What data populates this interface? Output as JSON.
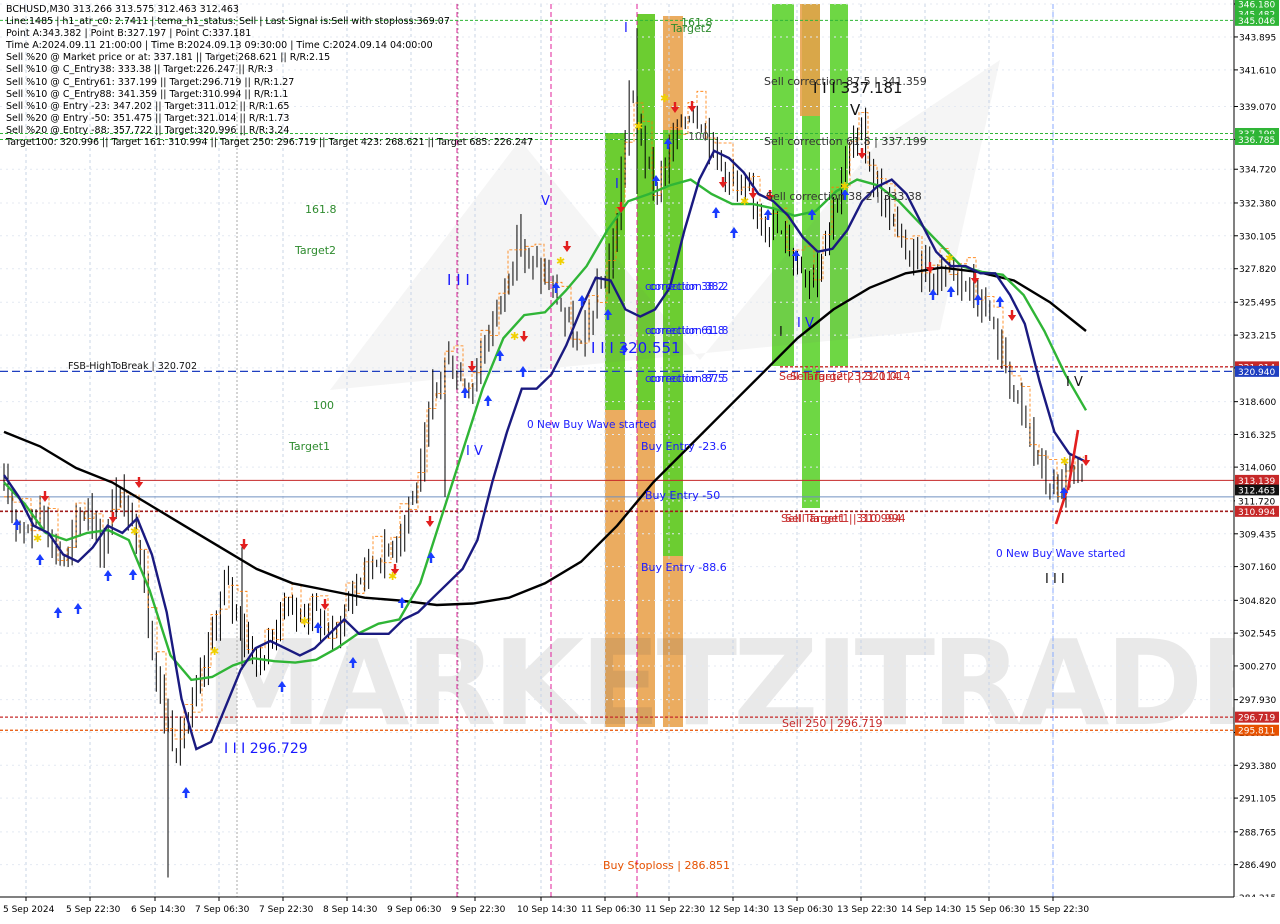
{
  "header": {
    "lines": [
      "BCHUSD,M30  313.266 313.575 312.463 312.463",
      "Line:1485  |  h1_atr_c0: 2.7411  |  tema_h1_status: Sell  |  Last Signal is:Sell with stoploss:369.07",
      "Point A:343.382  |  Point B:327.197  |  Point C:337.181",
      "Time A:2024.09.11 21:00:00  |  Time B:2024.09.13 09:30:00  |  Time C:2024.09.14 04:00:00",
      "Sell %20 @ Market price or at: 337.181  ||  Target:268.621  ||  R/R:2.15",
      "Sell %10 @ C_Entry38: 333.38  ||  Target:226.247  ||  R/R:3",
      "Sell %10 @ C_Entry61: 337.199  ||  Target:296.719  ||  R/R:1.27",
      "Sell %10 @ C_Entry88: 341.359  ||  Target:310.994  ||  R/R:1.1",
      "Sell %10 @ Entry -23: 347.202  ||  Target:311.012  ||  R/R:1.65",
      "Sell %20 @ Entry -50: 351.475  ||  Target:321.014  ||  R/R:1.73",
      "Sell %20 @ Entry -88: 357.722  ||  Target:320.996  ||  R/R:3.24",
      "Target100: 320.996  ||  Target 161: 310.994  ||  Target 250: 296.719  ||  Target 423: 268.621  ||  Target 685: 226.247"
    ]
  },
  "watermark": "MARKETZITRADE",
  "chart_data": {
    "type": "candlestick",
    "symbol": "BCHUSD",
    "timeframe": "M30",
    "ylim": [
      284.245,
      346.18
    ],
    "y_ticks": [
      "346.180",
      "343.895",
      "341.610",
      "339.070",
      "336.785",
      "334.720",
      "332.380",
      "330.105",
      "327.820",
      "325.495",
      "323.215",
      "320.940",
      "318.600",
      "316.325",
      "314.060",
      "311.720",
      "309.435",
      "307.160",
      "304.820",
      "302.545",
      "300.270",
      "297.930",
      "295.655",
      "293.380",
      "291.105",
      "288.765",
      "286.490",
      "284.215"
    ],
    "x_tick_labels": [
      "5 Sep 2024",
      "5 Sep 22:30",
      "6 Sep 14:30",
      "7 Sep 06:30",
      "7 Sep 22:30",
      "8 Sep 14:30",
      "9 Sep 06:30",
      "9 Sep 22:30",
      "10 Sep 14:30",
      "11 Sep 06:30",
      "11 Sep 22:30",
      "12 Sep 14:30",
      "13 Sep 06:30",
      "13 Sep 22:30",
      "14 Sep 14:30",
      "15 Sep 06:30",
      "15 Sep 22:30"
    ],
    "price_path": [
      312.5,
      310.5,
      309.8,
      311.5,
      308.5,
      307.5,
      310.2,
      311.5,
      307.8,
      312.5,
      311,
      309,
      302,
      297,
      294.5,
      296.5,
      299,
      302.5,
      306,
      304,
      301.5,
      300.5,
      302.5,
      305,
      303.5,
      304.5,
      303,
      302.3,
      304.5,
      306.5,
      307.5,
      308,
      309,
      311.5,
      313.5,
      319,
      321.5,
      320.5,
      319.5,
      322,
      324.5,
      327,
      330,
      328,
      327.5,
      326,
      324,
      322,
      325,
      327,
      330.5,
      340,
      337,
      333,
      335,
      337.5,
      339,
      338,
      336,
      334.5,
      333,
      332.5,
      331.5,
      330.5,
      329.5,
      328,
      327.2,
      330,
      333,
      336,
      337.2,
      334,
      332,
      330,
      328.5,
      328,
      327.2,
      328,
      327.5,
      326.5,
      325.5,
      323,
      320.5,
      318,
      315.5,
      313,
      312.5,
      313.5,
      312.46
    ],
    "moving_averages": {
      "navy": [
        313.5,
        312,
        310,
        309.5,
        308,
        307.5,
        308.5,
        310,
        309.5,
        310.5,
        308,
        304,
        298,
        294.5,
        295,
        297.5,
        300,
        301.5,
        302,
        301.5,
        301,
        301.5,
        302.5,
        303.5,
        302.5,
        302.5,
        302.5,
        303.5,
        304,
        305,
        306,
        307,
        309,
        313,
        316.5,
        319.5,
        319.5,
        320.5,
        322.5,
        325,
        327.2,
        327,
        325,
        324.5,
        325,
        326.5,
        330.5,
        334,
        336,
        335.5,
        334.5,
        333,
        332.5,
        331.5,
        330,
        329,
        329.2,
        330.5,
        332.5,
        333.5,
        334,
        333,
        331,
        329,
        328,
        328,
        327.5,
        327.5,
        326,
        324,
        320,
        316.5,
        315,
        314.5
      ],
      "green": [
        313,
        311.5,
        309.5,
        309,
        309.5,
        309.7,
        309,
        305.5,
        301,
        299.3,
        299.5,
        300.3,
        300.8,
        300.6,
        300.5,
        300.7,
        301.5,
        302.5,
        303.2,
        303.5,
        306,
        310.5,
        315,
        319.5,
        323,
        324.6,
        324.8,
        326.3,
        328,
        330.5,
        332.5,
        333,
        333.6,
        334,
        333,
        332.3,
        332.3,
        332,
        331.5,
        331.8,
        333.2,
        334,
        333.6,
        332.5,
        331,
        329.5,
        328,
        327.6,
        327.4,
        326,
        323.5,
        320.5,
        318
      ],
      "black": [
        316.5,
        315.5,
        314,
        313,
        311.5,
        310,
        308.5,
        307,
        306,
        305.5,
        305,
        304.8,
        304.5,
        304.6,
        305,
        306,
        307.5,
        310,
        313,
        315.5,
        318,
        320.5,
        323,
        325,
        326.5,
        327.5,
        327.9,
        327.6,
        327,
        325.5,
        323.5
      ]
    },
    "levels": [
      {
        "label": "FSB-HighToBreak | 320.702",
        "value": 320.702
      },
      {
        "label": "Sell Target2 | 321.014",
        "value": 321.014
      },
      {
        "label": "Sell Target1 | 310.994",
        "value": 310.994
      },
      {
        "label": "Sell 250 | 296.719",
        "value": 296.719
      }
    ],
    "price_badges": [
      {
        "text": "346.180",
        "value": 346.18,
        "bg": "#2fb536"
      },
      {
        "text": "345.482",
        "value": 345.482,
        "bg": "#2fb536"
      },
      {
        "text": "345.046",
        "value": 345.046,
        "bg": "#2fb536"
      },
      {
        "text": "337.199",
        "value": 337.199,
        "bg": "#2fb536"
      },
      {
        "text": "336.785",
        "value": 336.785,
        "bg": "#2fb536"
      },
      {
        "text": "321.014",
        "value": 321.014,
        "bg": "#c62828"
      },
      {
        "text": "320.940",
        "value": 320.702,
        "bg": "#1f3fc0"
      },
      {
        "text": "313.139",
        "value": 313.139,
        "bg": "#c62828"
      },
      {
        "text": "312.463",
        "value": 312.463,
        "bg": "#111111"
      },
      {
        "text": "311.720",
        "value": 311.72,
        "bg": "#ffffff"
      },
      {
        "text": "310.994",
        "value": 310.994,
        "bg": "#c62828"
      },
      {
        "text": "296.719",
        "value": 296.719,
        "bg": "#c62828"
      },
      {
        "text": "295.811",
        "value": 295.811,
        "bg": "#e65100"
      }
    ],
    "annotations": [
      {
        "text": "161.8",
        "color": "#2e8b2e"
      },
      {
        "text": "Target2",
        "color": "#2e8b2e"
      },
      {
        "text": "100",
        "color": "#2e8b2e"
      },
      {
        "text": "Target1",
        "color": "#2e8b2e"
      },
      {
        "text": "I I I",
        "color": "#1a1aff"
      },
      {
        "text": "V",
        "color": "#1a1aff"
      },
      {
        "text": "I V",
        "color": "#1a1aff"
      },
      {
        "text": "I I I 296.729",
        "color": "#1a1aff"
      },
      {
        "text": "correction 38.2",
        "color": "#1a1aff"
      },
      {
        "text": "correction 61.8",
        "color": "#1a1aff"
      },
      {
        "text": "correction 87.5",
        "color": "#1a1aff"
      },
      {
        "text": "0 New Buy Wave started",
        "color": "#1a1aff"
      },
      {
        "text": "I I I 320.551",
        "color": "#1a1aff"
      },
      {
        "text": "Buy Entry -23.6",
        "color": "#1a1aff"
      },
      {
        "text": "Buy Entry -50",
        "color": "#1a1aff"
      },
      {
        "text": "Buy Entry -88.6",
        "color": "#1a1aff"
      },
      {
        "text": "Buy Stoploss | 286.851",
        "color": "#e65100"
      },
      {
        "text": "161.8",
        "color": "#2e8b2e"
      },
      {
        "text": "Target2",
        "color": "#2e8b2e"
      },
      {
        "text": "100",
        "color": "#555555"
      },
      {
        "text": "Sell correction 87.5 | 341.359",
        "color": "#333333"
      },
      {
        "text": "I I I 337.181",
        "color": "#111111"
      },
      {
        "text": "V",
        "color": "#111111"
      },
      {
        "text": "Sell correction 61.8 | 337.199",
        "color": "#333333"
      },
      {
        "text": "Sell correction 38.2 | 333.38",
        "color": "#333333"
      },
      {
        "text": "I V",
        "color": "#1a1aff"
      },
      {
        "text": "Sell Target2 | 321.014",
        "color": "#c62828"
      },
      {
        "text": "Sell Target1 | 310.994",
        "color": "#c62828"
      },
      {
        "text": "Sell 250 | 296.719",
        "color": "#c62828"
      },
      {
        "text": "0 New Buy Wave started",
        "color": "#1a1aff"
      },
      {
        "text": "I I I",
        "color": "#111111"
      },
      {
        "text": "I V",
        "color": "#111111"
      },
      {
        "text": "I",
        "color": "#1a1aff"
      },
      {
        "text": "I",
        "color": "#1a1aff"
      },
      {
        "text": "I",
        "color": "#111111"
      }
    ],
    "zones": [
      {
        "name": "buy-zone",
        "color": "#e8a04a"
      },
      {
        "name": "buy-zone",
        "color": "#5ad12a"
      },
      {
        "name": "sell-zone",
        "color": "#5ad12a"
      },
      {
        "name": "sell-zone",
        "color": "#e8a04a"
      }
    ],
    "grid": true,
    "colors": {
      "bull": "#000000",
      "bear": "#000000",
      "ma_navy": "#1a1a80",
      "ma_green": "#2fb536",
      "ma_black": "#000000",
      "sell_arrow": "#e21f1f",
      "buy_arrow": "#1a3cff",
      "marker": "#f0d000"
    }
  }
}
